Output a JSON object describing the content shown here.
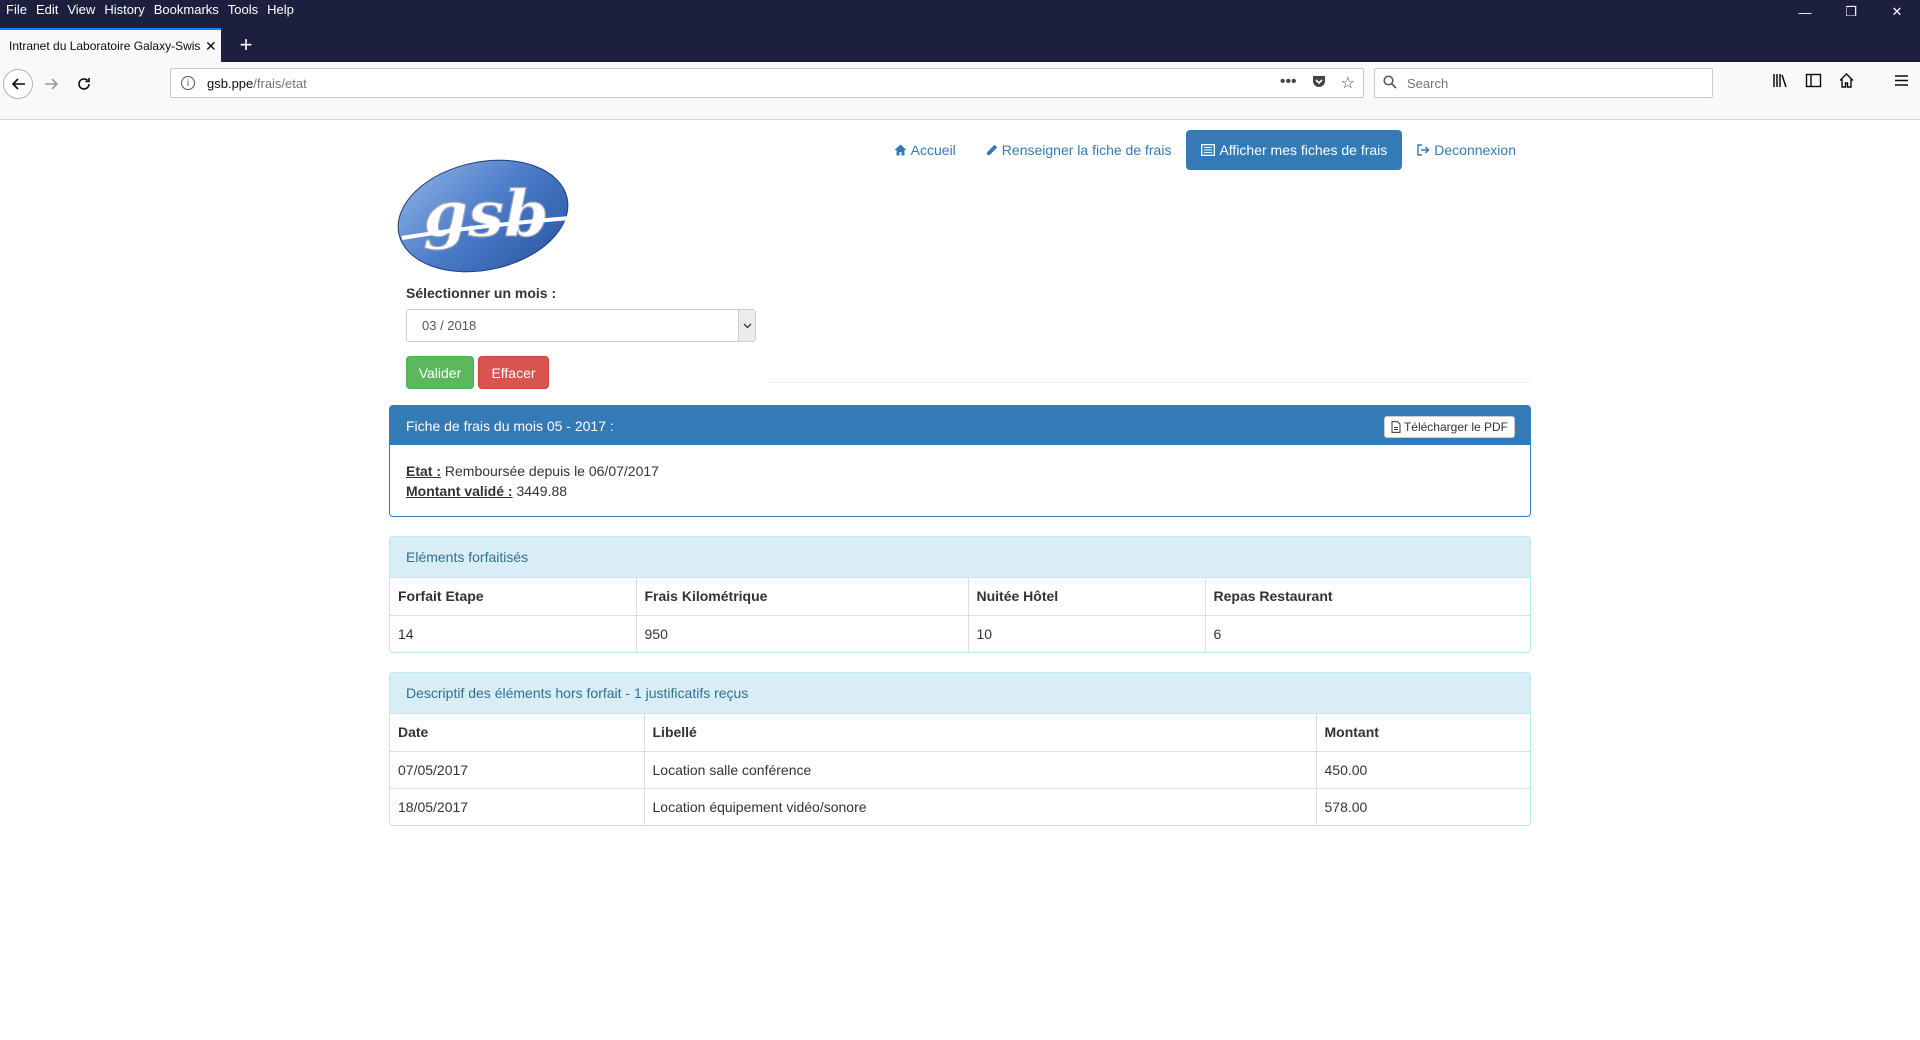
{
  "menubar": [
    "File",
    "Edit",
    "View",
    "History",
    "Bookmarks",
    "Tools",
    "Help"
  ],
  "tab": {
    "title": "Intranet du Laboratoire Galaxy-Swiss",
    "close": "✕"
  },
  "url": {
    "host": "gsb.ppe",
    "path": "/frais/etat"
  },
  "search": {
    "placeholder": "Search"
  },
  "nav": {
    "accueil": "Accueil",
    "renseigner": "Renseigner la fiche de frais",
    "afficher": "Afficher mes fiches de frais",
    "deconnexion": "Deconnexion"
  },
  "logo": {
    "text": "gsb"
  },
  "form": {
    "label": "Sélectionner un mois :",
    "selected_month": "03 / 2018",
    "valider": "Valider",
    "effacer": "Effacer"
  },
  "fiche": {
    "title": "Fiche de frais du mois 05 - 2017 :",
    "pdf_button": "Télécharger le PDF",
    "etat_label": "Etat :",
    "etat_value": "Remboursée depuis le 06/07/2017",
    "montant_label": "Montant validé :",
    "montant_value": "3449.88"
  },
  "forfait": {
    "title": "Eléments forfaitisés",
    "headers": [
      "Forfait Etape",
      "Frais Kilométrique",
      "Nuitée Hôtel",
      "Repas Restaurant"
    ],
    "values": [
      "14",
      "950",
      "10",
      "6"
    ]
  },
  "hors_forfait": {
    "title": "Descriptif des éléments hors forfait - 1 justificatifs reçus",
    "headers": [
      "Date",
      "Libellé",
      "Montant"
    ],
    "rows": [
      [
        "07/05/2017",
        "Location salle conférence",
        "450.00"
      ],
      [
        "18/05/2017",
        "Location équipement vidéo/sonore",
        "578.00"
      ]
    ]
  }
}
